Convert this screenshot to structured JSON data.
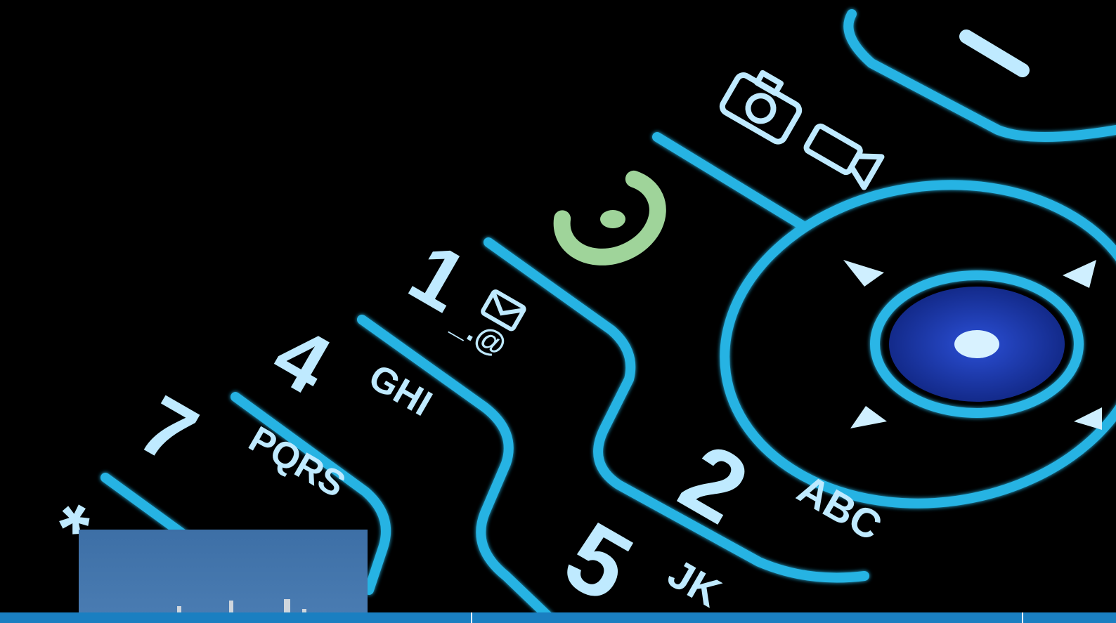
{
  "keys": {
    "key1": {
      "digit": "1",
      "sub": "_.@"
    },
    "key2": {
      "digit": "2",
      "sub": "ABC"
    },
    "key4": {
      "digit": "4",
      "sub": "GHI"
    },
    "key5": {
      "digit": "5",
      "sub": "JK"
    },
    "key7": {
      "digit": "7",
      "sub": "PQRS"
    },
    "star": {
      "digit": "*"
    }
  },
  "icons": {
    "send": "call-send-icon",
    "camera": "camera-icon",
    "video": "video-camera-icon",
    "message": "message-icon",
    "dash": "end-key-dash"
  },
  "colors": {
    "glow": "#29b6e6",
    "text": "#bfeaff",
    "green": "#9fd49a",
    "nav_center": "#1f3fbf",
    "bar": "#1a7fc1"
  }
}
